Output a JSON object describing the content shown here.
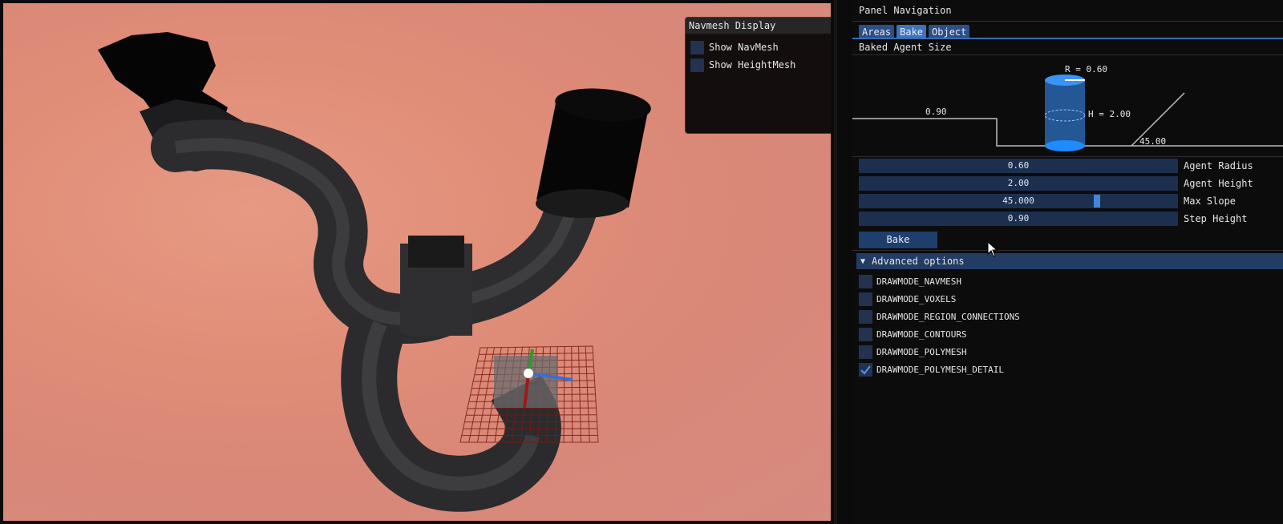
{
  "navmesh_display": {
    "title": "Navmesh Display",
    "options": [
      {
        "label": "Show NavMesh",
        "checked": false
      },
      {
        "label": "Show HeightMesh",
        "checked": false
      }
    ]
  },
  "panel": {
    "title": "Panel Navigation",
    "tabs": [
      {
        "label": "Areas",
        "active": false
      },
      {
        "label": "Bake",
        "active": true
      },
      {
        "label": "Object",
        "active": false
      }
    ],
    "section_label": "Baked Agent Size",
    "diagram": {
      "radius_label": "R = 0.60",
      "height_label": "H = 2.00",
      "step_label": "0.90",
      "slope_label": "45.00"
    },
    "fields": [
      {
        "value": "0.60",
        "label": "Agent Radius"
      },
      {
        "value": "2.00",
        "label": "Agent Height"
      },
      {
        "value": "45.000",
        "label": "Max Slope",
        "slider_fraction": 0.75
      },
      {
        "value": "0.90",
        "label": "Step Height"
      }
    ],
    "bake_label": "Bake",
    "advanced": {
      "label": "Advanced options",
      "drawmodes": [
        {
          "label": "DRAWMODE_NAVMESH",
          "checked": false
        },
        {
          "label": "DRAWMODE_VOXELS",
          "checked": false
        },
        {
          "label": "DRAWMODE_REGION_CONNECTIONS",
          "checked": false
        },
        {
          "label": "DRAWMODE_CONTOURS",
          "checked": false
        },
        {
          "label": "DRAWMODE_POLYMESH",
          "checked": false
        },
        {
          "label": "DRAWMODE_POLYMESH_DETAIL",
          "checked": true
        }
      ]
    }
  },
  "colors": {
    "accent": "#3e72bd",
    "checkbox_bg": "#23324e",
    "check_mark": "#4f8fe8",
    "viewport_bg": "#e08d78"
  }
}
